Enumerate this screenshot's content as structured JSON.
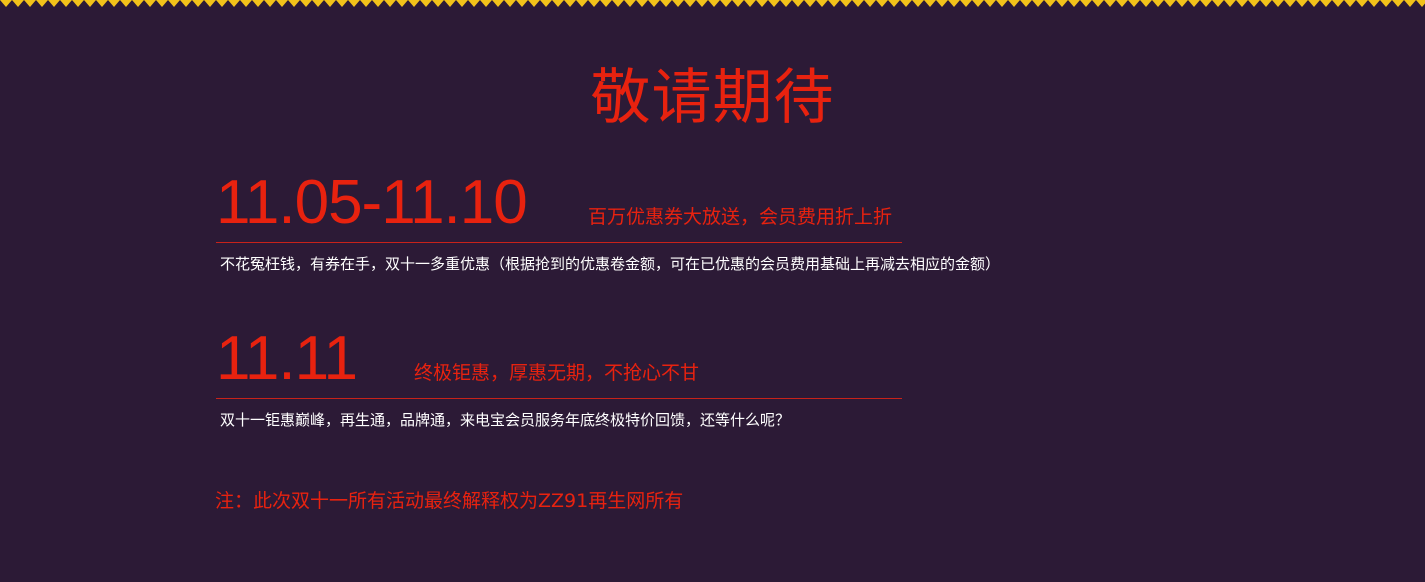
{
  "colors": {
    "background": "#2c1a36",
    "accent_red": "#e8220f",
    "border_yellow": "#f2c21a",
    "text_white": "#ffffff"
  },
  "header": {
    "title": "敬请期待"
  },
  "promotions": [
    {
      "date": "11.05-11.10",
      "tagline": "百万优惠券大放送，会员费用折上折",
      "description": "不花冤枉钱，有券在手，双十一多重优惠（根据抢到的优惠卷金额，可在已优惠的会员费用基础上再减去相应的金额）"
    },
    {
      "date": "11.11",
      "tagline": "终极钜惠，厚惠无期，不抢心不甘",
      "description": "双十一钜惠巅峰，再生通，品牌通，来电宝会员服务年底终极特价回馈，还等什么呢？"
    }
  ],
  "footer": {
    "note": "注：此次双十一所有活动最终解释权为ZZ91再生网所有"
  }
}
